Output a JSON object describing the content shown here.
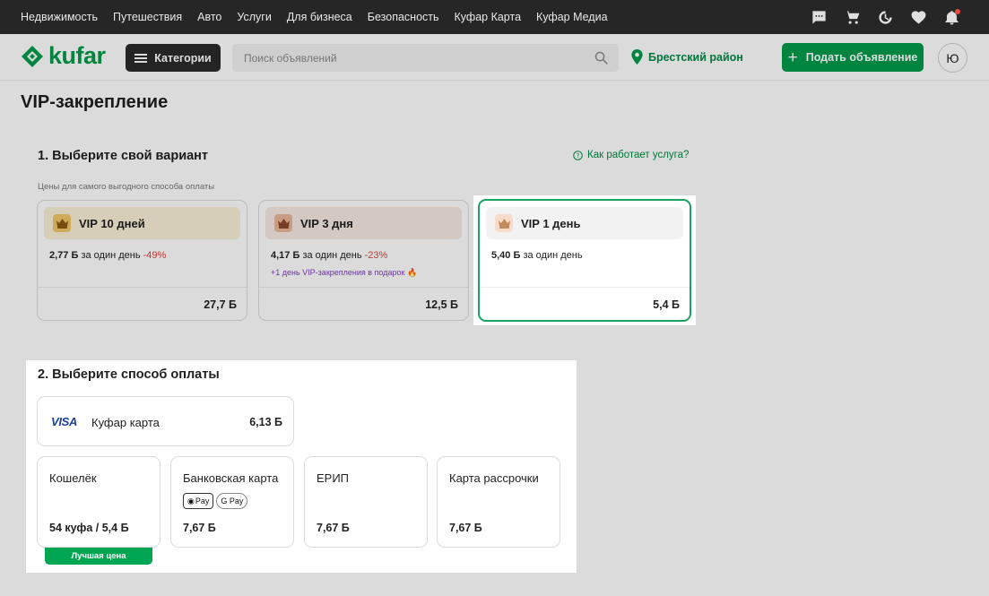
{
  "topnav": [
    "Недвижимость",
    "Путешествия",
    "Авто",
    "Услуги",
    "Для бизнеса",
    "Безопасность",
    "Куфар Карта",
    "Куфар Медиа"
  ],
  "top_icons": [
    "chat-icon",
    "cart-icon",
    "history-icon",
    "heart-icon",
    "bell-icon"
  ],
  "header": {
    "logo_text": "kufar",
    "categories_label": "Категории",
    "search_placeholder": "Поиск объявлений",
    "location": "Брестский район",
    "post_ad_label": "Подать объявление",
    "avatar_letter": "Ю"
  },
  "page_title": "VIP-закрепление",
  "step1": {
    "title": "1. Выберите свой вариант",
    "help_link": "Как работает услуга?",
    "hint": "Цены для самого выгодного способа оплаты",
    "options": [
      {
        "name": "VIP 10 дней",
        "per_day": "2,77 Б",
        "per_day_suffix": "за один день",
        "discount": "-49%",
        "gift": "",
        "total": "27,7 Б",
        "selected": false
      },
      {
        "name": "VIP 3 дня",
        "per_day": "4,17 Б",
        "per_day_suffix": "за один день",
        "discount": "-23%",
        "gift": "+1 день VIP-закрепления в подарок",
        "total": "12,5 Б",
        "selected": false
      },
      {
        "name": "VIP 1 день",
        "per_day": "5,40 Б",
        "per_day_suffix": "за один день",
        "discount": "",
        "gift": "",
        "total": "5,4 Б",
        "selected": true
      }
    ]
  },
  "step2": {
    "title": "2. Выберите способ оплаты",
    "kufar_card": {
      "brand": "VISA",
      "label": "Куфар карта",
      "price": "6,13 Б"
    },
    "methods": [
      {
        "label": "Кошелёк",
        "price": "54 куфа / 5,4 Б",
        "badge": "Лучшая цена"
      },
      {
        "label": "Банковская карта",
        "price": "7,67 Б",
        "pay_badges": [
          "Pay",
          "G Pay"
        ]
      },
      {
        "label": "ЕРИП",
        "price": "7,67 Б"
      },
      {
        "label": "Карта рассрочки",
        "price": "7,67 Б"
      }
    ]
  },
  "colors": {
    "brand": "#009b4c",
    "dark": "#262626",
    "discount": "#e0413a",
    "gift": "#7b3fb8"
  }
}
